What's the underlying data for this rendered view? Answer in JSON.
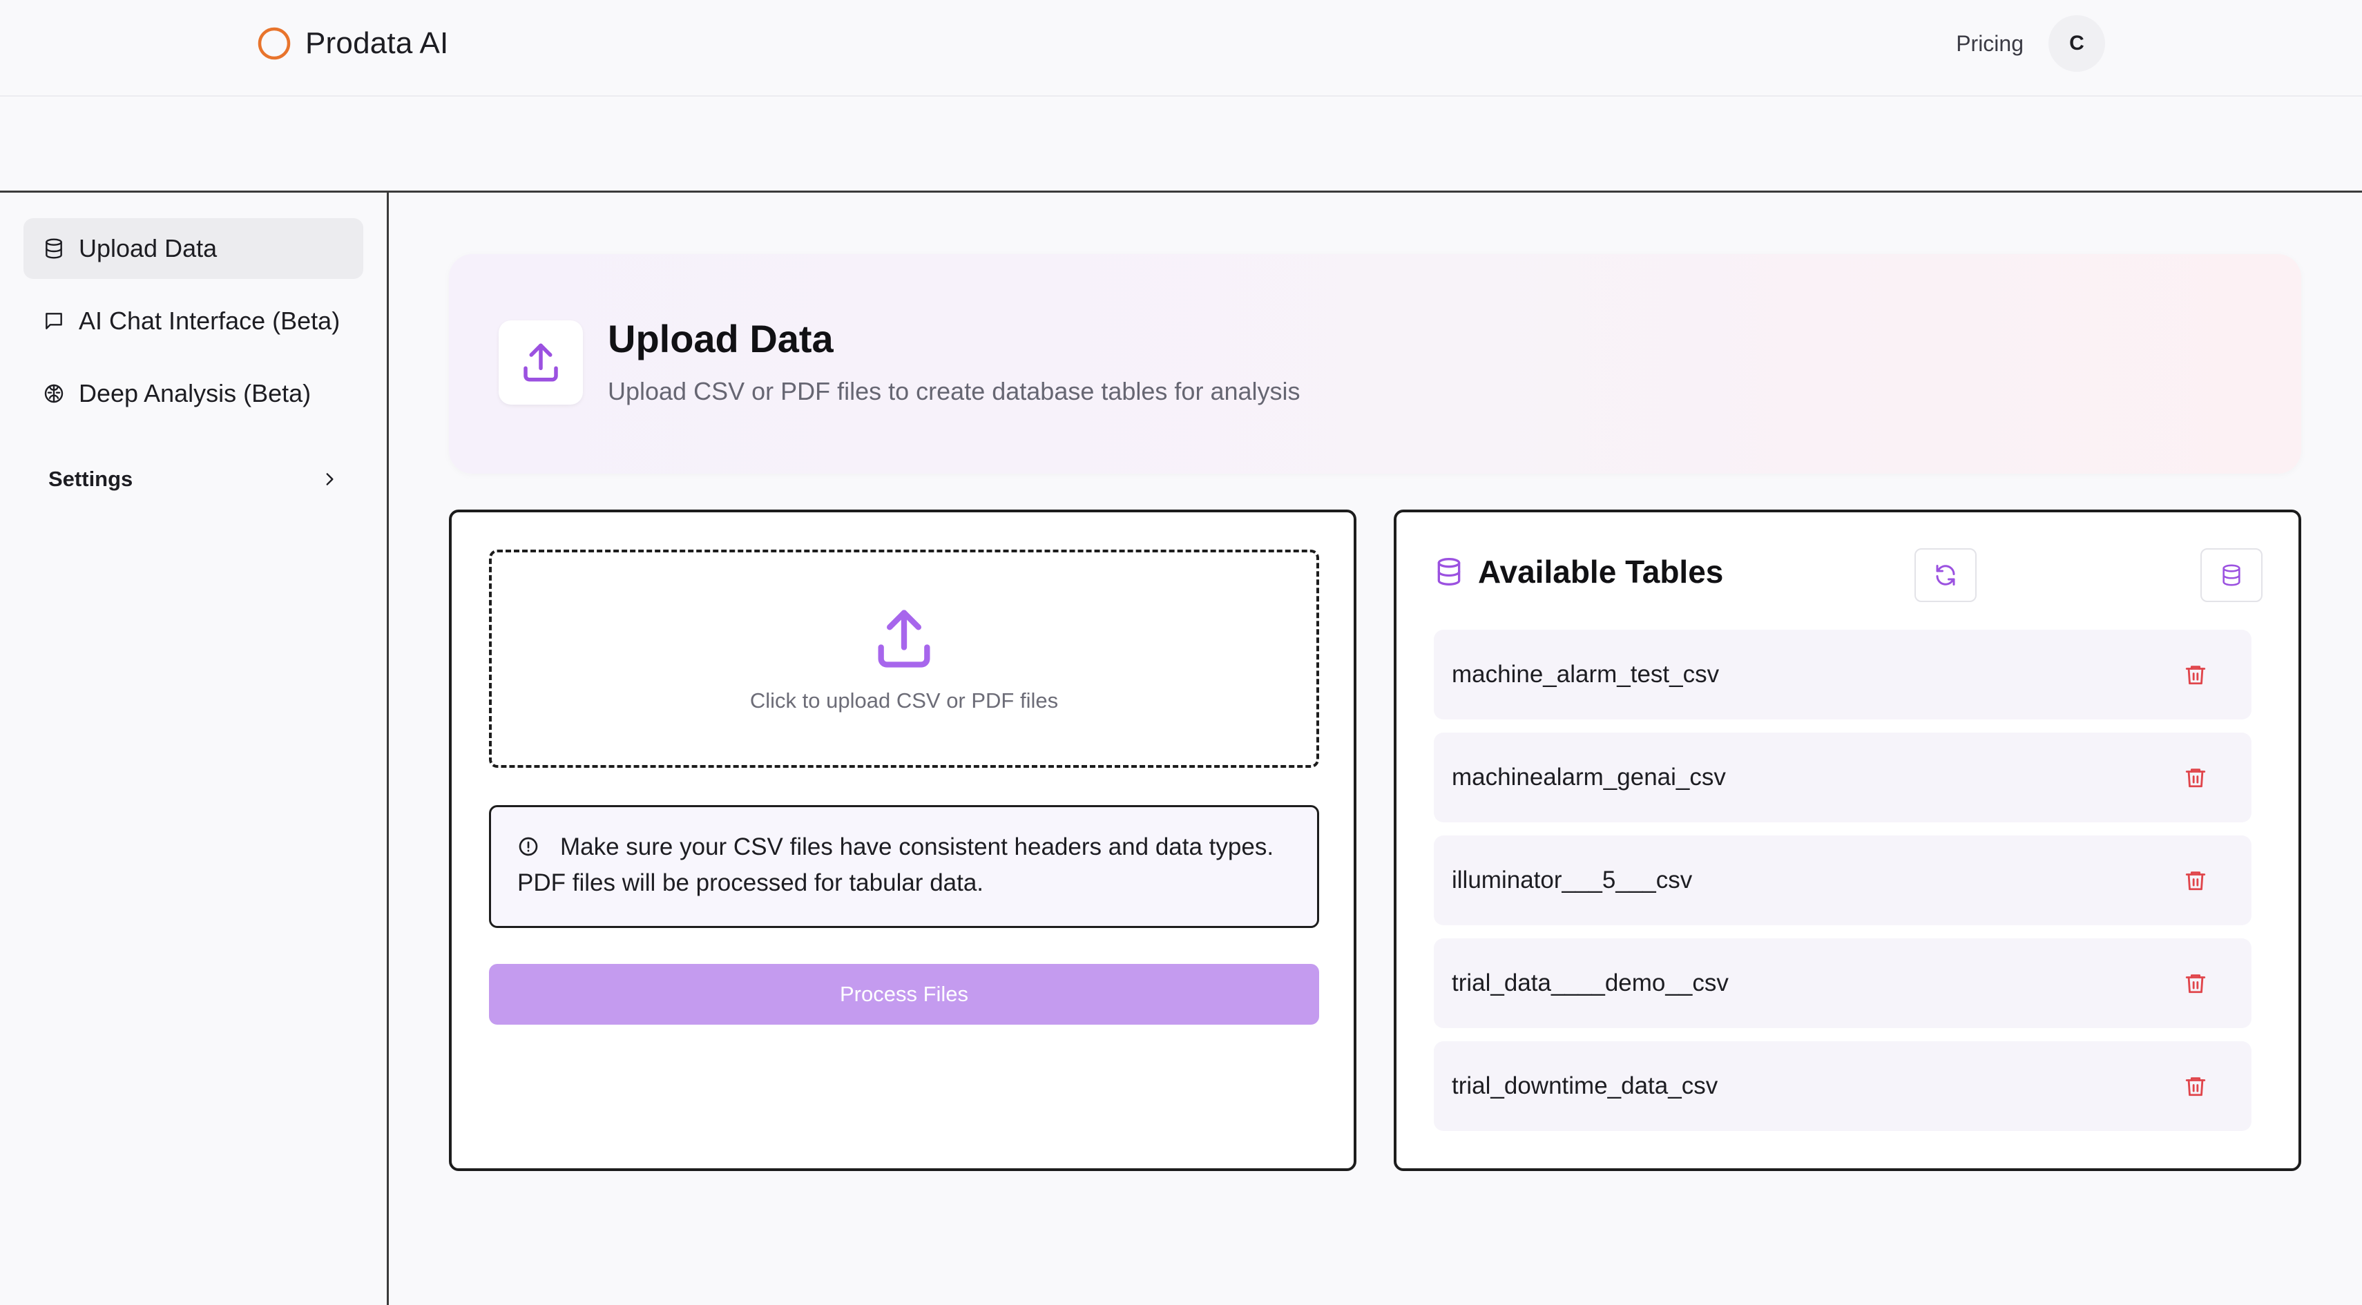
{
  "topnav": {
    "brand_name": "Prodata AI",
    "pricing_label": "Pricing",
    "avatar_initial": "C"
  },
  "sidebar": {
    "items": [
      {
        "label": "Upload Data",
        "icon": "database-icon",
        "active": true
      },
      {
        "label": "AI Chat Interface (Beta)",
        "icon": "chat-icon",
        "active": false
      },
      {
        "label": "Deep Analysis (Beta)",
        "icon": "brain-icon",
        "active": false
      }
    ],
    "settings_label": "Settings"
  },
  "header": {
    "title": "Upload Data",
    "subtitle": "Upload CSV or PDF files to create database tables for analysis"
  },
  "upload": {
    "dropzone_text": "Click to upload CSV or PDF files",
    "info_text": "Make sure your CSV files have consistent headers and data types. PDF files will be processed for tabular data.",
    "process_button_label": "Process Files"
  },
  "tables": {
    "title": "Available Tables",
    "items": [
      {
        "name": "machine_alarm_test_csv"
      },
      {
        "name": "machinealarm_genai_csv"
      },
      {
        "name": "illuminator___5___csv"
      },
      {
        "name": "trial_data____demo__csv"
      },
      {
        "name": "trial_downtime_data_csv"
      }
    ]
  },
  "colors": {
    "accent": "#9b51e0",
    "button_disabled": "#c49bef",
    "brand_ring": "#e8742c",
    "delete": "#e0454b"
  }
}
